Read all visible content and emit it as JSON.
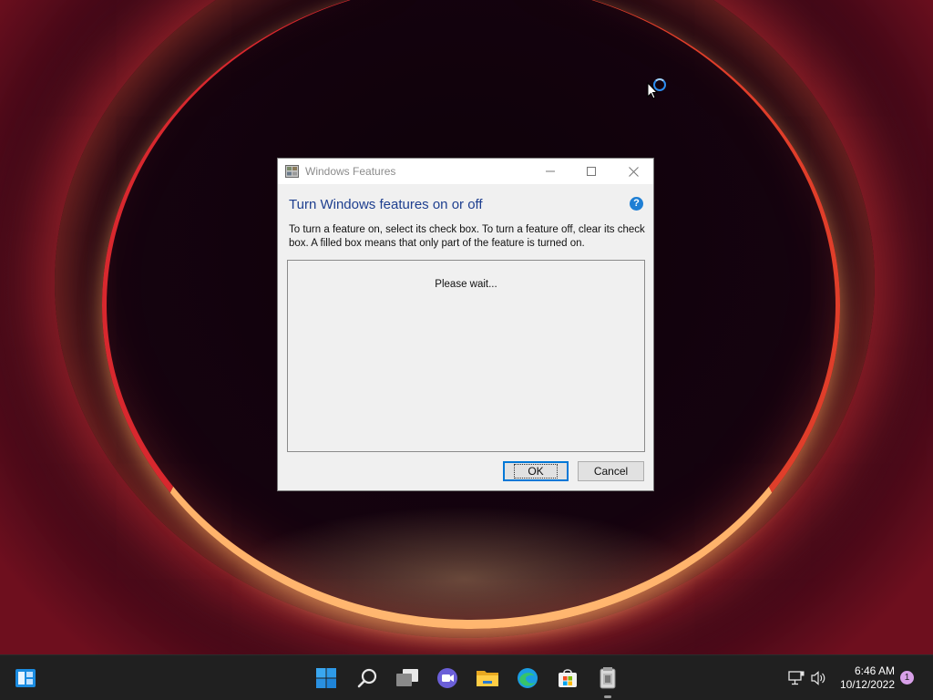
{
  "dialog": {
    "title": "Windows Features",
    "heading": "Turn Windows features on or off",
    "help_symbol": "?",
    "description": "To turn a feature on, select its check box. To turn a feature off, clear its check box. A filled box means that only part of the feature is turned on.",
    "list_status": "Please wait...",
    "ok_label": "OK",
    "cancel_label": "Cancel"
  },
  "taskbar": {
    "icons": [
      "widgets-icon",
      "start-icon",
      "search-icon",
      "task-view-icon",
      "chat-icon",
      "file-explorer-icon",
      "edge-icon",
      "store-icon",
      "windows-features-icon"
    ],
    "time": "6:46 AM",
    "date": "10/12/2022",
    "notification_count": "1"
  },
  "colors": {
    "heading": "#1e3f8f",
    "accent": "#0078d7",
    "taskbar": "#202020",
    "badge": "#d8a0e8"
  }
}
